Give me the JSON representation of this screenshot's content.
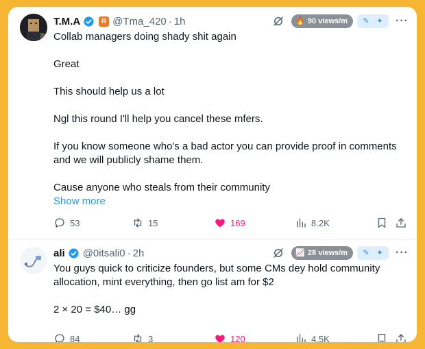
{
  "tweets": [
    {
      "name": "T.M.A",
      "rbadge": "R",
      "handle": "@Tma_420",
      "sep": "·",
      "time": "1h",
      "views_badge": "90 views/m",
      "views_icon": "fire-icon",
      "lines": [
        "Collab managers doing shady shit again",
        "Great",
        "This should help us a lot",
        "Ngl this round I'll help you cancel these mfers.",
        "If you know someone who's a bad actor you can provide proof in comments and we will publicly shame them.",
        "Cause anyone who steals from their community"
      ],
      "show_more": "Show more",
      "replies": "53",
      "reposts": "15",
      "likes": "169",
      "views": "8.2K"
    },
    {
      "name": "ali",
      "handle": "@0itsali0",
      "sep": "·",
      "time": "2h",
      "views_badge": "28 views/m",
      "views_icon": "trend-icon",
      "lines": [
        "You guys quick to criticize founders, but some CMs dey hold community allocation, mint everything, then go list am for $2",
        "2 × 20 = $40… gg"
      ],
      "replies": "84",
      "reposts": "3",
      "likes": "120",
      "views": "4.5K"
    }
  ],
  "colors": {
    "background": "#f6b633",
    "like": "#f91880",
    "link": "#1d9bf0",
    "verified": "#1d9bf0"
  }
}
